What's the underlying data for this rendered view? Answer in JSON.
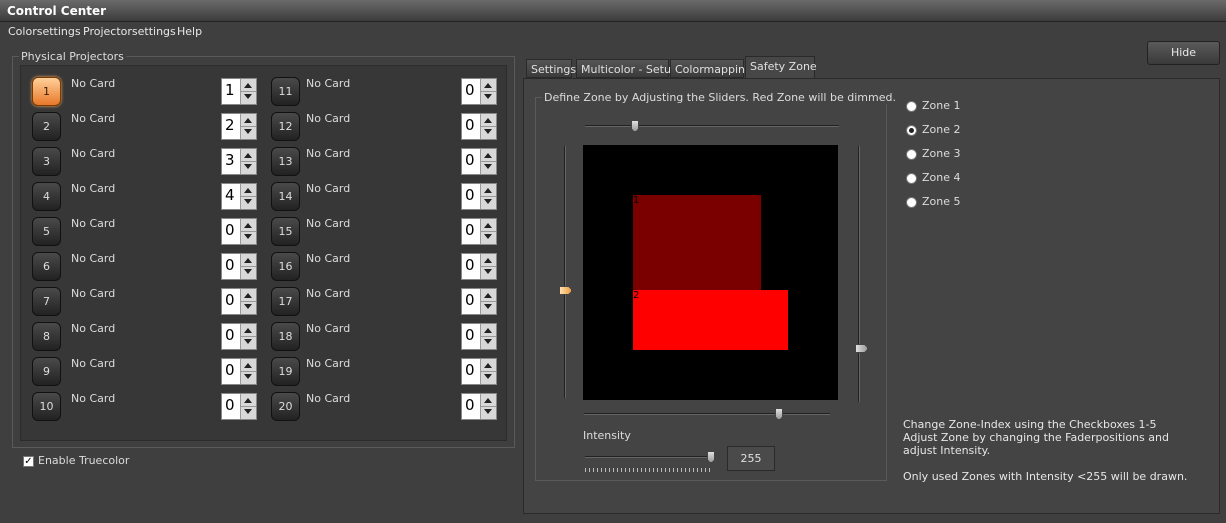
{
  "window": {
    "title": "Control Center"
  },
  "menu": [
    "Colorsettings",
    "Projectorsettings",
    "Help"
  ],
  "physical_projectors": {
    "title": "Physical Projectors",
    "projectors": [
      {
        "id": "1",
        "card": "No Card",
        "value": "1",
        "active": true
      },
      {
        "id": "2",
        "card": "No Card",
        "value": "2"
      },
      {
        "id": "3",
        "card": "No Card",
        "value": "3"
      },
      {
        "id": "4",
        "card": "No Card",
        "value": "4"
      },
      {
        "id": "5",
        "card": "No Card",
        "value": "0"
      },
      {
        "id": "6",
        "card": "No Card",
        "value": "0"
      },
      {
        "id": "7",
        "card": "No Card",
        "value": "0"
      },
      {
        "id": "8",
        "card": "No Card",
        "value": "0"
      },
      {
        "id": "9",
        "card": "No Card",
        "value": "0"
      },
      {
        "id": "10",
        "card": "No Card",
        "value": "0"
      },
      {
        "id": "11",
        "card": "No Card",
        "value": "0"
      },
      {
        "id": "12",
        "card": "No Card",
        "value": "0"
      },
      {
        "id": "13",
        "card": "No Card",
        "value": "0"
      },
      {
        "id": "14",
        "card": "No Card",
        "value": "0"
      },
      {
        "id": "15",
        "card": "No Card",
        "value": "0"
      },
      {
        "id": "16",
        "card": "No Card",
        "value": "0"
      },
      {
        "id": "17",
        "card": "No Card",
        "value": "0"
      },
      {
        "id": "18",
        "card": "No Card",
        "value": "0"
      },
      {
        "id": "19",
        "card": "No Card",
        "value": "0"
      },
      {
        "id": "20",
        "card": "No Card",
        "value": "0"
      }
    ]
  },
  "truecolor": {
    "label": "Enable Truecolor",
    "checked": true,
    "mark": "✓"
  },
  "hide_button": "Hide",
  "tabs": [
    {
      "label": "Settings"
    },
    {
      "label": "Multicolor - Setup"
    },
    {
      "label": "Colormapping"
    },
    {
      "label": "Safety Zone",
      "active": true
    }
  ],
  "safety_zone": {
    "group_title": "Define Zone by Adjusting the Sliders. Red Zone will be dimmed.",
    "zones": [
      {
        "label": "1",
        "color": "#7a0000"
      },
      {
        "label": "2",
        "color": "#ff0000"
      }
    ],
    "radios": [
      {
        "label": "Zone 1",
        "checked": false
      },
      {
        "label": "Zone 2",
        "checked": true
      },
      {
        "label": "Zone 3",
        "checked": false
      },
      {
        "label": "Zone 4",
        "checked": false
      },
      {
        "label": "Zone 5",
        "checked": false
      }
    ],
    "intensity_label": "Intensity",
    "intensity_value": "255",
    "info": {
      "line1": "Change Zone-Index using the Checkboxes 1-5",
      "line2": "Adjust Zone by changing the Faderpositions and",
      "line3": "adjust Intensity.",
      "line4": "Only used Zones with Intensity <255 will be drawn."
    }
  },
  "colors": {
    "accent": "#f0a040",
    "dim_zone": "#7a0000",
    "active_zone": "#ff0000"
  }
}
